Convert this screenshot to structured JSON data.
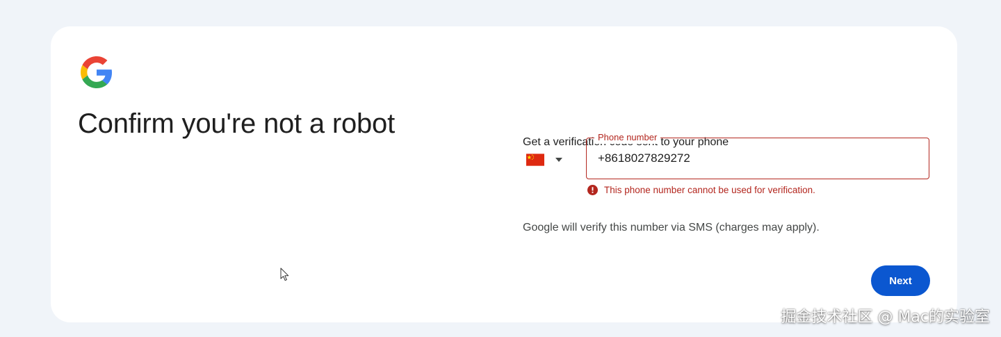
{
  "page": {
    "title": "Confirm you're not a robot"
  },
  "form": {
    "intro": "Get a verification code sent to your phone",
    "country": {
      "flag_icon": "china-flag-icon",
      "dropdown_icon": "caret-down-icon"
    },
    "phone": {
      "label": "Phone number",
      "value": "+8618027829272"
    },
    "error": {
      "icon": "error-circle-icon",
      "message": "This phone number cannot be used for verification."
    },
    "sms_note": "Google will verify this number via SMS (charges may apply).",
    "next_label": "Next"
  },
  "watermark": {
    "text": "掘金技术社区 @ Mac的实验室"
  },
  "colors": {
    "page_background": "#f0f4f9",
    "card_background": "#ffffff",
    "error": "#b3261e",
    "primary_button": "#0b57d0",
    "text": "#1f1f1f"
  }
}
